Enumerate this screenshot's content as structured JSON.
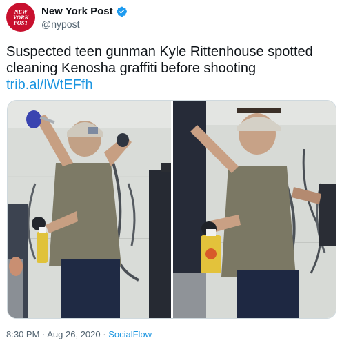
{
  "account": {
    "display_name": "New York Post",
    "handle": "@nypost",
    "avatar_logo": [
      "NEW",
      "YORK",
      "POST"
    ],
    "verified": true
  },
  "tweet": {
    "text_lines": [
      "Suspected teen gunman Kyle Rittenhouse spotted",
      "cleaning Kenosha graffiti before shooting"
    ],
    "link": "trib.al/lWtEFfh"
  },
  "media": {
    "photos": [
      {
        "subject": "teen cleaning graffiti, back view"
      },
      {
        "subject": "teen cleaning graffiti, looking at camera"
      }
    ]
  },
  "meta": {
    "time": "8:30 PM",
    "separator": " · ",
    "date": "Aug 26, 2020",
    "separator2": " · ",
    "source": "SocialFlow"
  },
  "colors": {
    "brand_red": "#c8102e",
    "link_blue": "#1b95e0",
    "verified_blue": "#1d9bf0"
  }
}
